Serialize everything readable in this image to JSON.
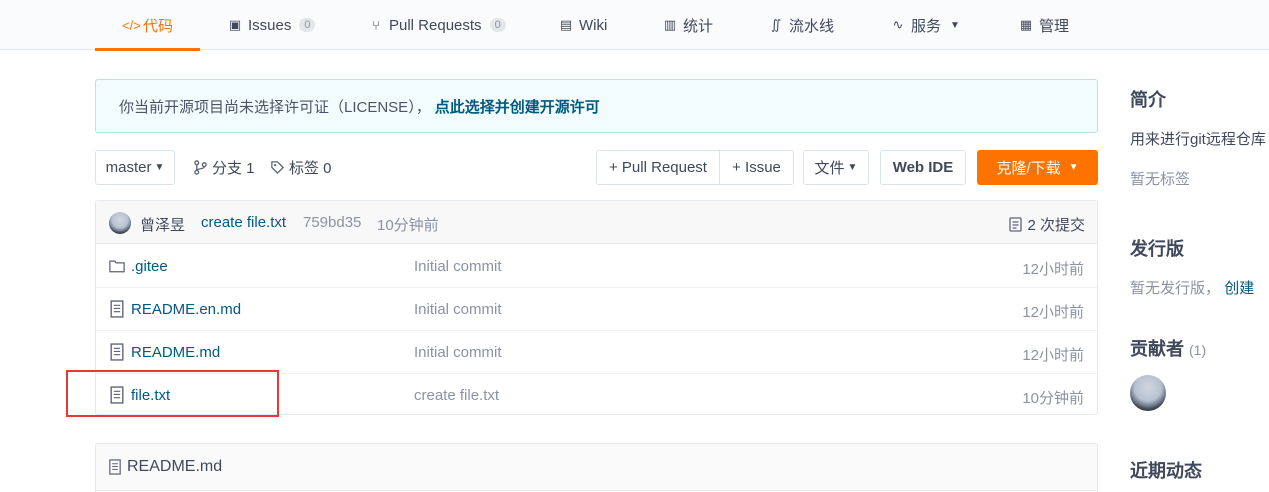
{
  "nav": {
    "tabs": [
      {
        "icon": "</>",
        "label": "代码"
      },
      {
        "icon": "▣",
        "label": "Issues",
        "count": "0"
      },
      {
        "icon": "⑂",
        "label": "Pull Requests",
        "count": "0"
      },
      {
        "icon": "▤",
        "label": "Wiki"
      },
      {
        "icon": "▥",
        "label": "统计"
      },
      {
        "icon": "∬",
        "label": "流水线"
      },
      {
        "icon": "∿",
        "label": "服务"
      },
      {
        "icon": "▦",
        "label": "管理"
      }
    ]
  },
  "license": {
    "text": "你当前开源项目尚未选择许可证（LICENSE），",
    "link": "点此选择并创建开源许可"
  },
  "toolbar": {
    "branch": "master",
    "branches_label": "分支 1",
    "tags_label": "标签 0",
    "pull_request": "+ Pull Request",
    "issue": "+ Issue",
    "file": "文件",
    "web_ide": "Web IDE",
    "clone": "克隆/下载"
  },
  "commit": {
    "author": "曾泽昱",
    "message": "create file.txt",
    "hash": "759bd35",
    "time": "10分钟前",
    "total": "2 次提交"
  },
  "files": [
    {
      "type": "folder",
      "name": ".gitee",
      "message": "Initial commit",
      "time": "12小时前"
    },
    {
      "type": "file",
      "name": "README.en.md",
      "message": "Initial commit",
      "time": "12小时前"
    },
    {
      "type": "file",
      "name": "README.md",
      "message": "Initial commit",
      "time": "12小时前"
    },
    {
      "type": "file",
      "name": "file.txt",
      "message": "create file.txt",
      "time": "10分钟前"
    }
  ],
  "readme": {
    "title": "README.md"
  },
  "sidebar": {
    "intro_heading": "简介",
    "intro_text": "用来进行git远程仓库",
    "no_tags": "暂无标签",
    "release_heading": "发行版",
    "no_release": "暂无发行版，",
    "create_link": "创建",
    "contributors_heading": "贡献者",
    "contributors_count": "(1)",
    "activity_heading": "近期动态"
  },
  "colors": {
    "accent": "#fe7300",
    "link": "#005980",
    "highlight": "#e53935"
  }
}
